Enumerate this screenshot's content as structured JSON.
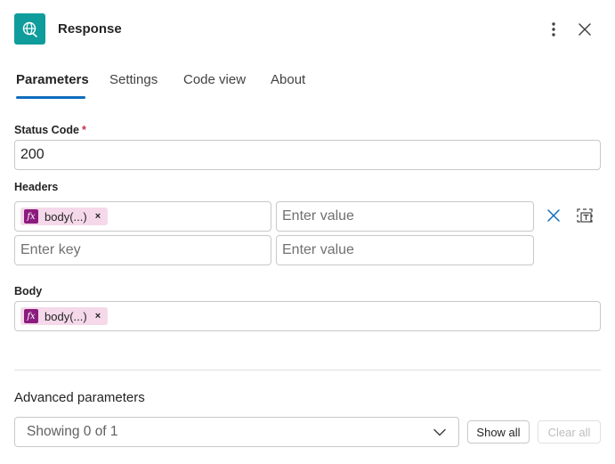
{
  "header": {
    "title": "Response",
    "icon": "globe-icon"
  },
  "tabs": [
    {
      "label": "Parameters",
      "active": true
    },
    {
      "label": "Settings",
      "active": false
    },
    {
      "label": "Code view",
      "active": false
    },
    {
      "label": "About",
      "active": false
    }
  ],
  "status_code": {
    "label": "Status Code",
    "required_mark": "*",
    "value": "200"
  },
  "headers": {
    "label": "Headers",
    "rows": [
      {
        "key_token": "body(...)",
        "value_placeholder": "Enter value"
      },
      {
        "key_placeholder": "Enter key",
        "value_placeholder": "Enter value"
      }
    ]
  },
  "body": {
    "label": "Body",
    "token": "body(...)"
  },
  "advanced": {
    "label": "Advanced parameters",
    "dropdown_value": "Showing 0 of 1",
    "show_all_label": "Show all",
    "clear_all_label": "Clear all"
  },
  "colors": {
    "brand": "#0f9c9c",
    "accent": "#0f6cbd",
    "token_bg": "#f5d9ea",
    "token_icon": "#8b1c7e",
    "required": "#c4314b"
  }
}
